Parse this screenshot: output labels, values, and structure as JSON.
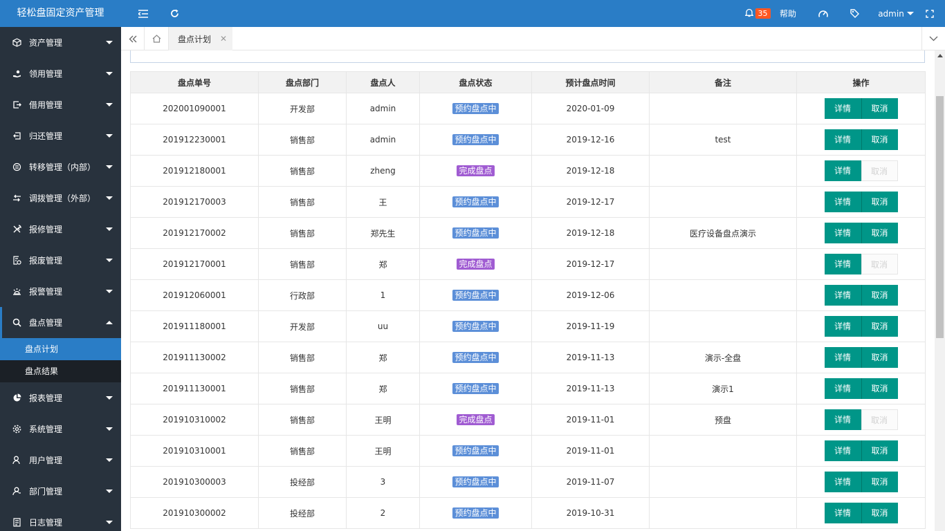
{
  "header": {
    "app_title": "轻松盘固定资产管理",
    "notification_count": "35",
    "help_label": "帮助",
    "user_name": "admin"
  },
  "sidebar": {
    "items": [
      {
        "label": "资产管理",
        "icon": "cube-icon"
      },
      {
        "label": "领用管理",
        "icon": "hand-icon"
      },
      {
        "label": "借用管理",
        "icon": "borrow-icon"
      },
      {
        "label": "归还管理",
        "icon": "return-icon"
      },
      {
        "label": "转移管理（内部）",
        "icon": "transfer-icon"
      },
      {
        "label": "调拨管理（外部）",
        "icon": "allocate-icon"
      },
      {
        "label": "报修管理",
        "icon": "wrench-icon"
      },
      {
        "label": "报废管理",
        "icon": "scrap-icon"
      },
      {
        "label": "报警管理",
        "icon": "alarm-icon"
      },
      {
        "label": "盘点管理",
        "icon": "search-icon"
      }
    ],
    "sub_items": [
      {
        "label": "盘点计划"
      },
      {
        "label": "盘点结果"
      }
    ],
    "items_after": [
      {
        "label": "报表管理",
        "icon": "pie-chart-icon"
      },
      {
        "label": "系统管理",
        "icon": "gear-icon"
      },
      {
        "label": "用户管理",
        "icon": "user-icon"
      },
      {
        "label": "部门管理",
        "icon": "department-icon"
      },
      {
        "label": "日志管理",
        "icon": "log-icon"
      }
    ]
  },
  "tabs": {
    "active_tab": "盘点计划"
  },
  "table": {
    "columns": [
      "盘点单号",
      "盘点部门",
      "盘点人",
      "盘点状态",
      "预计盘点时间",
      "备注",
      "操作"
    ],
    "detail_label": "详情",
    "cancel_label": "取消",
    "rows": [
      {
        "id": "202001090001",
        "dept": "开发部",
        "person": "admin",
        "status": "预约盘点中",
        "status_type": "pending",
        "date": "2020-01-09",
        "note": "",
        "cancel_enabled": true
      },
      {
        "id": "201912230001",
        "dept": "销售部",
        "person": "admin",
        "status": "预约盘点中",
        "status_type": "pending",
        "date": "2019-12-16",
        "note": "test",
        "cancel_enabled": true
      },
      {
        "id": "201912180001",
        "dept": "销售部",
        "person": "zheng",
        "status": "完成盘点",
        "status_type": "done",
        "date": "2019-12-18",
        "note": "",
        "cancel_enabled": false
      },
      {
        "id": "201912170003",
        "dept": "销售部",
        "person": "王",
        "status": "预约盘点中",
        "status_type": "pending",
        "date": "2019-12-17",
        "note": "",
        "cancel_enabled": true
      },
      {
        "id": "201912170002",
        "dept": "销售部",
        "person": "郑先生",
        "status": "预约盘点中",
        "status_type": "pending",
        "date": "2019-12-18",
        "note": "医疗设备盘点演示",
        "cancel_enabled": true
      },
      {
        "id": "201912170001",
        "dept": "销售部",
        "person": "郑",
        "status": "完成盘点",
        "status_type": "done",
        "date": "2019-12-17",
        "note": "",
        "cancel_enabled": false
      },
      {
        "id": "201912060001",
        "dept": "行政部",
        "person": "1",
        "status": "预约盘点中",
        "status_type": "pending",
        "date": "2019-12-06",
        "note": "",
        "cancel_enabled": true
      },
      {
        "id": "201911180001",
        "dept": "开发部",
        "person": "uu",
        "status": "预约盘点中",
        "status_type": "pending",
        "date": "2019-11-19",
        "note": "",
        "cancel_enabled": true
      },
      {
        "id": "201911130002",
        "dept": "销售部",
        "person": "郑",
        "status": "预约盘点中",
        "status_type": "pending",
        "date": "2019-11-13",
        "note": "演示-全盘",
        "cancel_enabled": true
      },
      {
        "id": "201911130001",
        "dept": "销售部",
        "person": "郑",
        "status": "预约盘点中",
        "status_type": "pending",
        "date": "2019-11-13",
        "note": "演示1",
        "cancel_enabled": true
      },
      {
        "id": "201910310002",
        "dept": "销售部",
        "person": "王明",
        "status": "完成盘点",
        "status_type": "done",
        "date": "2019-11-01",
        "note": "预盘",
        "cancel_enabled": false
      },
      {
        "id": "201910310001",
        "dept": "销售部",
        "person": "王明",
        "status": "预约盘点中",
        "status_type": "pending",
        "date": "2019-11-01",
        "note": "",
        "cancel_enabled": true
      },
      {
        "id": "201910300003",
        "dept": "投经部",
        "person": "3",
        "status": "预约盘点中",
        "status_type": "pending",
        "date": "2019-11-07",
        "note": "",
        "cancel_enabled": true
      },
      {
        "id": "201910300002",
        "dept": "投经部",
        "person": "2",
        "status": "预约盘点中",
        "status_type": "pending",
        "date": "2019-10-31",
        "note": "",
        "cancel_enabled": true
      }
    ]
  },
  "colors": {
    "header_blue": "#2a7dc6",
    "sidebar_bg": "#28323d",
    "btn_teal": "#009688",
    "status_pending": "#5c8fd8",
    "status_done": "#a05cd2",
    "notify_badge": "#ff5722"
  }
}
